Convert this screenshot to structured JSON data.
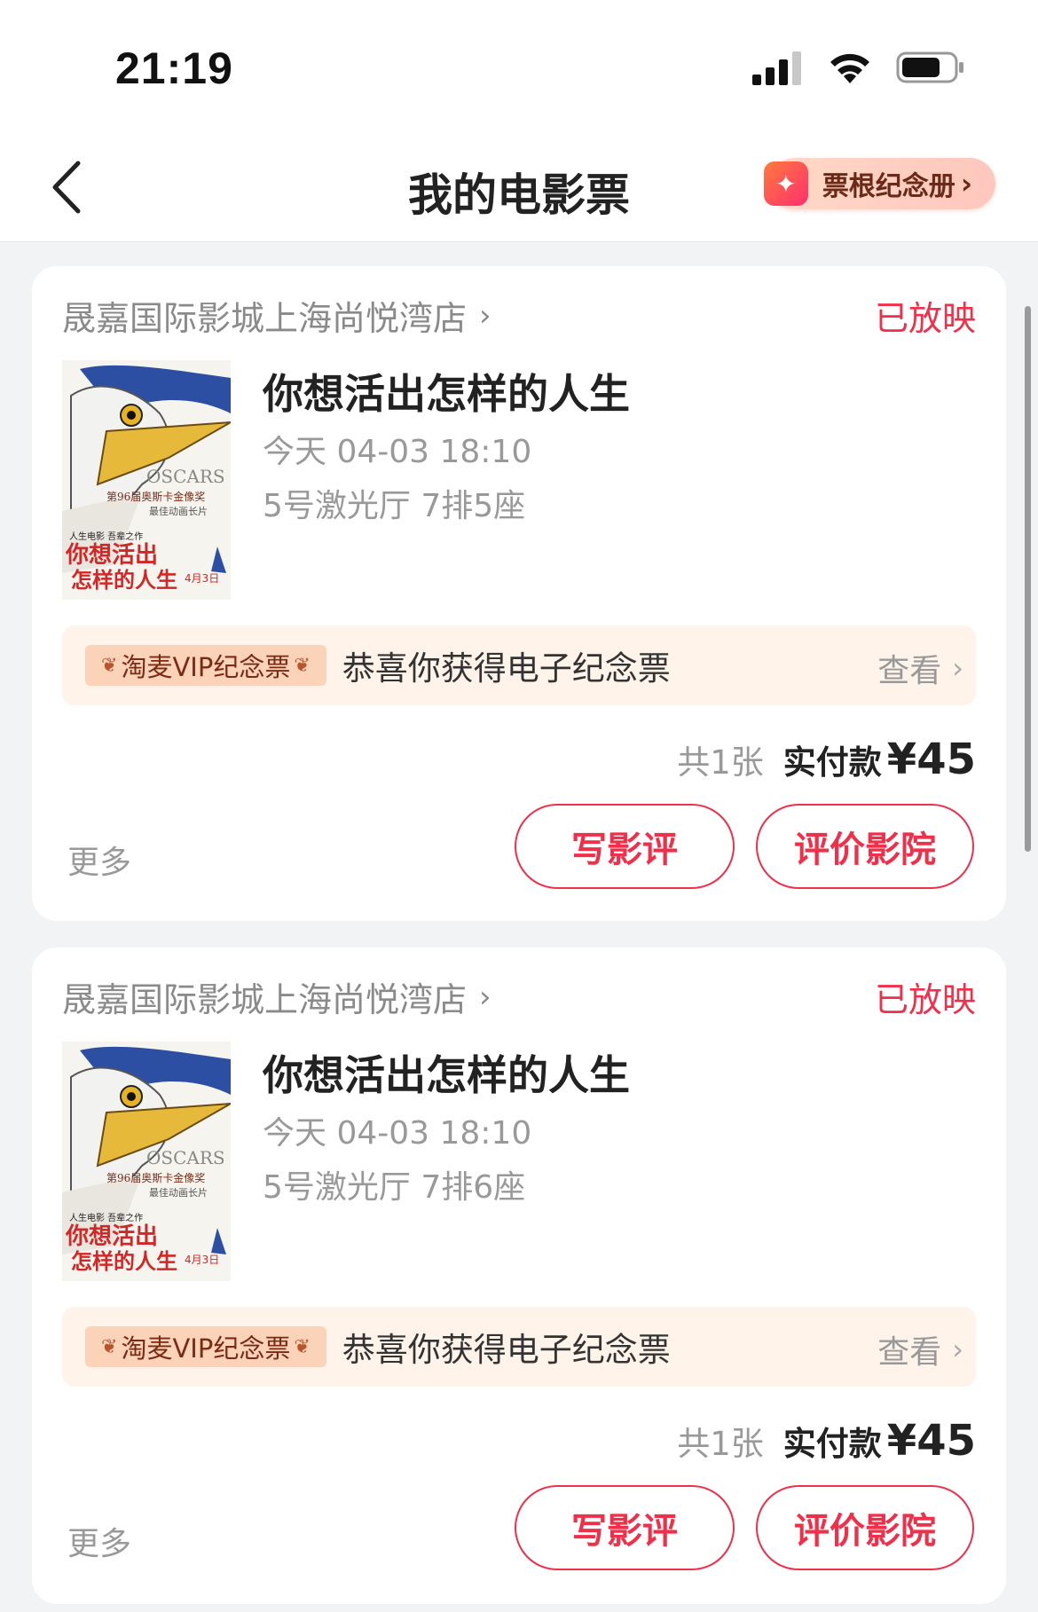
{
  "status_bar": {
    "time": "21:19"
  },
  "nav": {
    "title": "我的电影票",
    "stub_button": "票根纪念册"
  },
  "tickets": [
    {
      "cinema": "晟嘉国际影城上海尚悦湾店",
      "status": "已放映",
      "movie_title": "你想活出怎样的人生",
      "showtime": "今天 04-03 18:10",
      "seat": "5号激光厅 7排5座",
      "poster": {
        "badge": "OSCARS",
        "award_line1": "第96届奥斯卡金像奖",
        "award_line2": "最佳动画长片",
        "tagline": "人生电影 吾辈之作",
        "title_art_line1": "你想活出",
        "title_art_line2": "怎样的人生",
        "release_date": "4月3日"
      },
      "vip_badge": "淘麦VIP纪念票",
      "vip_text": "恭喜你获得电子纪念票",
      "vip_link": "查看",
      "count": "共1张",
      "paid_label": "实付款",
      "paid_amount": "¥45",
      "more": "更多",
      "btn_review": "写影评",
      "btn_rate": "评价影院"
    },
    {
      "cinema": "晟嘉国际影城上海尚悦湾店",
      "status": "已放映",
      "movie_title": "你想活出怎样的人生",
      "showtime": "今天 04-03 18:10",
      "seat": "5号激光厅 7排6座",
      "poster": {
        "badge": "OSCARS",
        "award_line1": "第96届奥斯卡金像奖",
        "award_line2": "最佳动画长片",
        "tagline": "人生电影 吾辈之作",
        "title_art_line1": "你想活出",
        "title_art_line2": "怎样的人生",
        "release_date": "4月3日"
      },
      "vip_badge": "淘麦VIP纪念票",
      "vip_text": "恭喜你获得电子纪念票",
      "vip_link": "查看",
      "count": "共1张",
      "paid_label": "实付款",
      "paid_amount": "¥45",
      "more": "更多",
      "btn_review": "写影评",
      "btn_rate": "评价影院"
    }
  ],
  "colors": {
    "accent": "#f0304a",
    "page_bg": "#f2f3f5",
    "vip_bg": "#fff3ea"
  }
}
